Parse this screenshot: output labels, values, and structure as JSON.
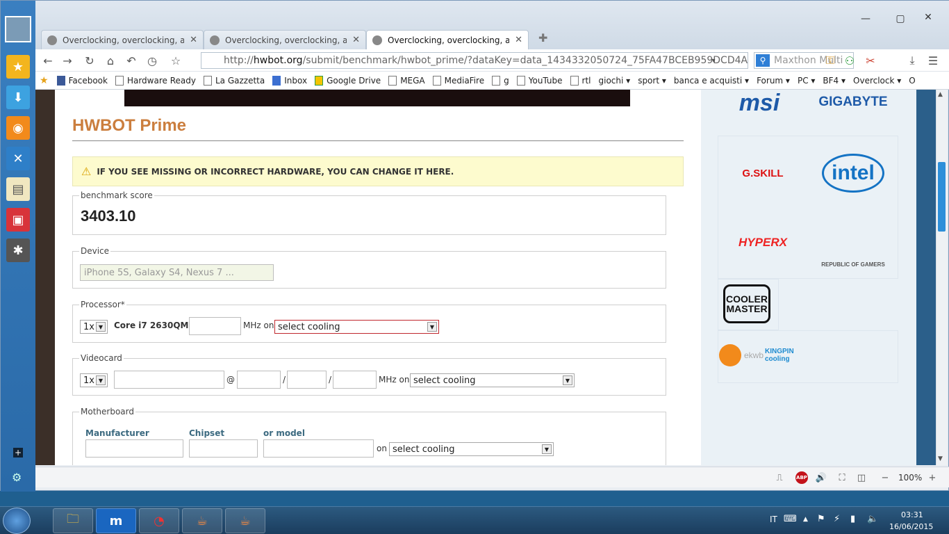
{
  "browser": {
    "tabs": [
      {
        "label": "Overclocking, overclocking, and..."
      },
      {
        "label": "Overclocking, overclocking, and..."
      },
      {
        "label": "Overclocking, overclocking, a..."
      }
    ],
    "address_prefix": "http://",
    "address_host": "hwbot.org",
    "address_path": "/submit/benchmark/hwbot_prime/?dataKey=data_1434332050724_75FA47BCEB959DCD4A",
    "search_placeholder": "Maxthon Multi",
    "bookmarks": [
      "Facebook",
      "Hardware Ready",
      "La Gazzetta",
      "Inbox",
      "Google Drive",
      "MEGA",
      "MediaFire",
      "g",
      "YouTube",
      "rtl",
      "giochi ▾",
      "sport ▾",
      "banca e acquisti ▾",
      "Forum ▾",
      "PC ▾",
      "BF4 ▾",
      "Overclock ▾",
      "O"
    ],
    "zoom": "100%"
  },
  "page": {
    "title": "HWBOT Prime",
    "warning": "IF YOU SEE MISSING OR INCORRECT HARDWARE, YOU CAN CHANGE IT HERE.",
    "score_legend": "benchmark score",
    "score_value": "3403.10",
    "device_legend": "Device",
    "device_placeholder": "iPhone 5S, Galaxy S4, Nexus 7 ...",
    "processor_legend": "Processor*",
    "processor_count": "1x",
    "processor_name": "Core i7 2630QM @",
    "mhz_on": "MHz on",
    "select_cooling": "select cooling",
    "videocard_legend": "Videocard",
    "videocard_count": "1x",
    "at": "@",
    "slash": "/",
    "motherboard_legend": "Motherboard",
    "mb_manufacturer": "Manufacturer",
    "mb_chipset": "Chipset",
    "mb_model": "or model",
    "on": "on"
  },
  "sponsors": [
    "msi",
    "GIGABYTE",
    "G.SKILL",
    "intel",
    "HYPERX",
    "REPUBLIC OF GAMERS",
    "COOLER MASTER",
    "ekwb",
    "KINGPIN cooling"
  ],
  "taskbar": {
    "lang": "IT",
    "time": "03:31",
    "date": "16/06/2015"
  },
  "colors": {
    "title": "#cb7e3e",
    "warning_bg": "#fdfbce",
    "error_border": "#c0272d"
  }
}
